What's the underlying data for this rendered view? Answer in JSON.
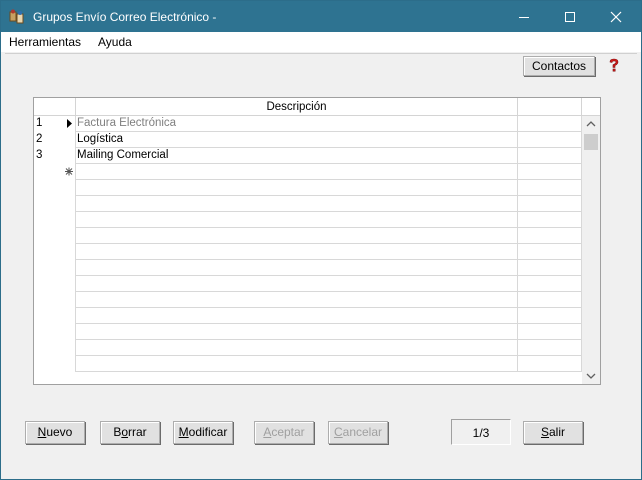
{
  "window": {
    "title": "Grupos Envío Correo Electrónico -",
    "controls": {
      "minimize": "minimize-icon",
      "maximize": "maximize-icon",
      "close": "close-icon"
    }
  },
  "menu": {
    "items": [
      "Herramientas",
      "Ayuda"
    ]
  },
  "toolbar": {
    "contacts_label": "Contactos",
    "help_icon": "help-icon"
  },
  "grid": {
    "column_header": "Descripción",
    "rows": [
      {
        "number": "1",
        "marker": "current-row-arrow",
        "description": "Factura Electrónica",
        "muted": true
      },
      {
        "number": "2",
        "marker": "",
        "description": "Logística",
        "muted": false
      },
      {
        "number": "3",
        "marker": "",
        "description": "Mailing Comercial",
        "muted": false
      }
    ],
    "new_row_marker": "new-row-asterisk"
  },
  "buttons": {
    "nuevo": {
      "underline": "N",
      "rest": "uevo",
      "enabled": true
    },
    "borrar": {
      "pre": "B",
      "underline": "o",
      "rest": "rrar",
      "enabled": true
    },
    "modificar": {
      "underline": "M",
      "rest": "odificar",
      "enabled": true
    },
    "aceptar": {
      "underline": "A",
      "rest": "ceptar",
      "enabled": false
    },
    "cancelar": {
      "underline": "C",
      "rest": "ancelar",
      "enabled": false
    },
    "salir": {
      "underline": "S",
      "rest": "alir",
      "enabled": true
    }
  },
  "record_counter": "1/3",
  "colors": {
    "titlebar": "#2e7391",
    "face": "#f0f0f0",
    "disabled_text": "#a0a0a0"
  }
}
